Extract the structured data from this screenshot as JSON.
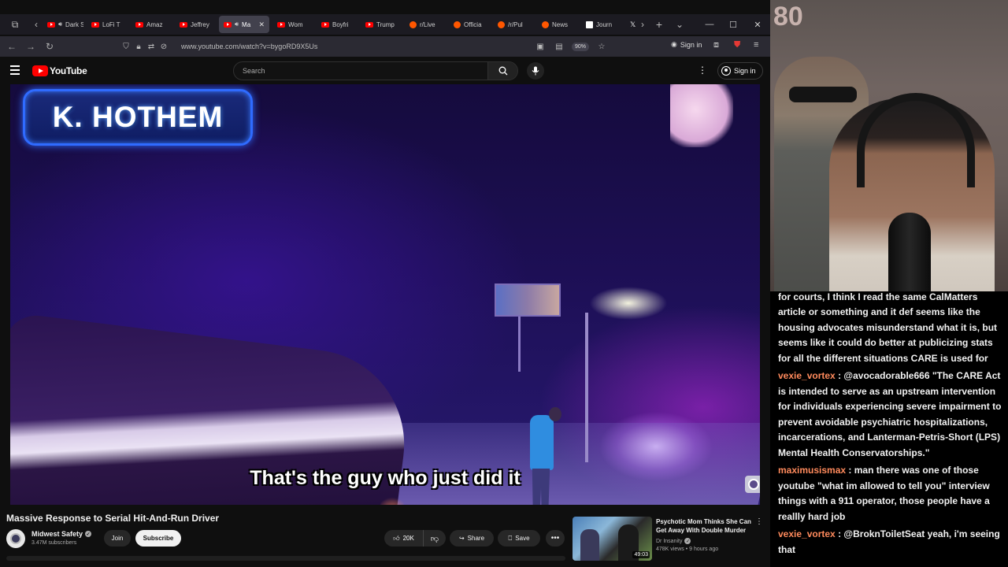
{
  "browser": {
    "tabs": [
      {
        "label": "Dark S",
        "icon": "youtube-icon",
        "audio": true,
        "active": false
      },
      {
        "label": "LoFi T",
        "icon": "youtube-icon",
        "audio": false,
        "active": false
      },
      {
        "label": "Amaz",
        "icon": "youtube-icon",
        "audio": false,
        "active": false
      },
      {
        "label": "Jeffrey",
        "icon": "youtube-icon",
        "audio": false,
        "active": false
      },
      {
        "label": "Ma",
        "icon": "youtube-icon",
        "audio": true,
        "active": true
      },
      {
        "label": "Wom",
        "icon": "youtube-icon",
        "audio": false,
        "active": false
      },
      {
        "label": "Boyfri",
        "icon": "youtube-icon",
        "audio": false,
        "active": false
      },
      {
        "label": "Trump",
        "icon": "youtube-icon",
        "audio": false,
        "active": false
      },
      {
        "label": "r/Live",
        "icon": "reddit-icon",
        "audio": false,
        "active": false
      },
      {
        "label": "Officia",
        "icon": "reddit-icon",
        "audio": false,
        "active": false
      },
      {
        "label": "/r/Pul",
        "icon": "reddit-icon",
        "audio": false,
        "active": false
      },
      {
        "label": "News",
        "icon": "reddit-icon",
        "audio": false,
        "active": false
      },
      {
        "label": "Journ",
        "icon": "journal-icon",
        "audio": false,
        "active": false
      }
    ],
    "url": "www.youtube.com/watch?v=bygoRD9X5Us",
    "zoom": "90%",
    "signin_label": "Sign in"
  },
  "youtube": {
    "logo_text": "YouTube",
    "search_placeholder": "Search",
    "signin_label": "Sign in"
  },
  "video": {
    "name_badge": "K. HOTHEM",
    "caption": "That's the guy who just did it",
    "title": "Massive Response to Serial Hit-And-Run Driver",
    "channel": "Midwest Safety",
    "subscribers": "3.47M subscribers",
    "join_label": "Join",
    "subscribe_label": "Subscribe",
    "likes": "20K",
    "share_label": "Share",
    "save_label": "Save"
  },
  "recommendation": {
    "title": "Psychotic Mom Thinks She Can Get Away With Double Murder",
    "channel": "Dr Insanity",
    "meta": "478K views • 9 hours ago",
    "duration": "49:03"
  },
  "overlay": {
    "cam_sign": "80",
    "chat": [
      {
        "user": "",
        "text": "for courts, I think I read the same CalMatters article or something and it def seems like the housing advocates misunderstand what it is, but seems like it could do better at publicizing stats for all the different situations CARE is used for"
      },
      {
        "user": "vexie_vortex",
        "text": "@avocadorable666 \"The CARE Act is intended to serve as an upstream intervention for individuals experiencing severe impairment to prevent avoidable psychiatric hospitalizations, incarcerations, and Lanterman-Petris-Short (LPS) Mental Health Conservatorships.\""
      },
      {
        "user": "maximusismax",
        "text": "man there was one of those youtube \"what im allowed to tell you\" interview things with a 911 operator, those people have a reallly hard job"
      },
      {
        "user": "vexie_vortex",
        "text": "@BroknToiletSeat yeah, i'm seeing that"
      }
    ]
  },
  "colors": {
    "yt_red": "#ff0000",
    "chat_user": "#ff8a5c",
    "badge_blue": "#2f6bff"
  }
}
